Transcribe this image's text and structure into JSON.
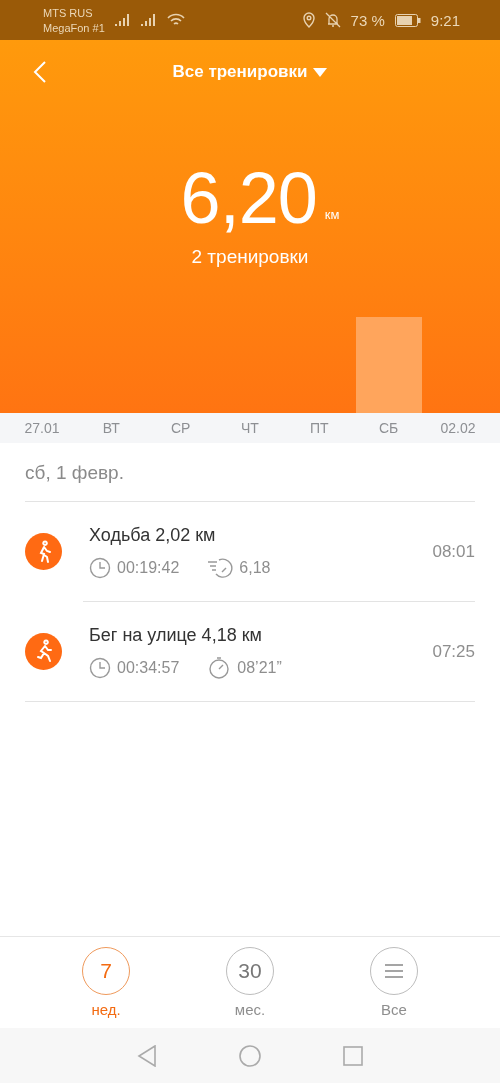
{
  "status_bar": {
    "carrier_1": "MTS RUS",
    "carrier_2": "MegaFon #1",
    "battery": "73 %",
    "time": "9:21"
  },
  "header": {
    "title": "Все тренировки",
    "total": "6,20",
    "unit": "км",
    "count": "2 тренировки"
  },
  "days": [
    {
      "label": "27.01"
    },
    {
      "label": "ВТ"
    },
    {
      "label": "СР"
    },
    {
      "label": "ЧТ"
    },
    {
      "label": "ПТ"
    },
    {
      "label": "СБ"
    },
    {
      "label": "02.02"
    }
  ],
  "date": "сб, 1 февр.",
  "workouts": [
    {
      "kind": "walk",
      "title": "Ходьба 2,02 км",
      "duration": "00:19:42",
      "metric": {
        "kind": "speed",
        "value": "6,18"
      },
      "time": "08:01"
    },
    {
      "kind": "run",
      "title": "Бег на улице 4,18 км",
      "duration": "00:34:57",
      "metric": {
        "kind": "pace",
        "value": "08’21”"
      },
      "time": "07:25"
    }
  ],
  "periods": [
    {
      "kind": "number",
      "label": "7",
      "caption": "нед.",
      "selected": true
    },
    {
      "kind": "number",
      "label": "30",
      "caption": "мес.",
      "selected": false
    },
    {
      "kind": "list",
      "caption": "Все",
      "selected": false
    }
  ]
}
